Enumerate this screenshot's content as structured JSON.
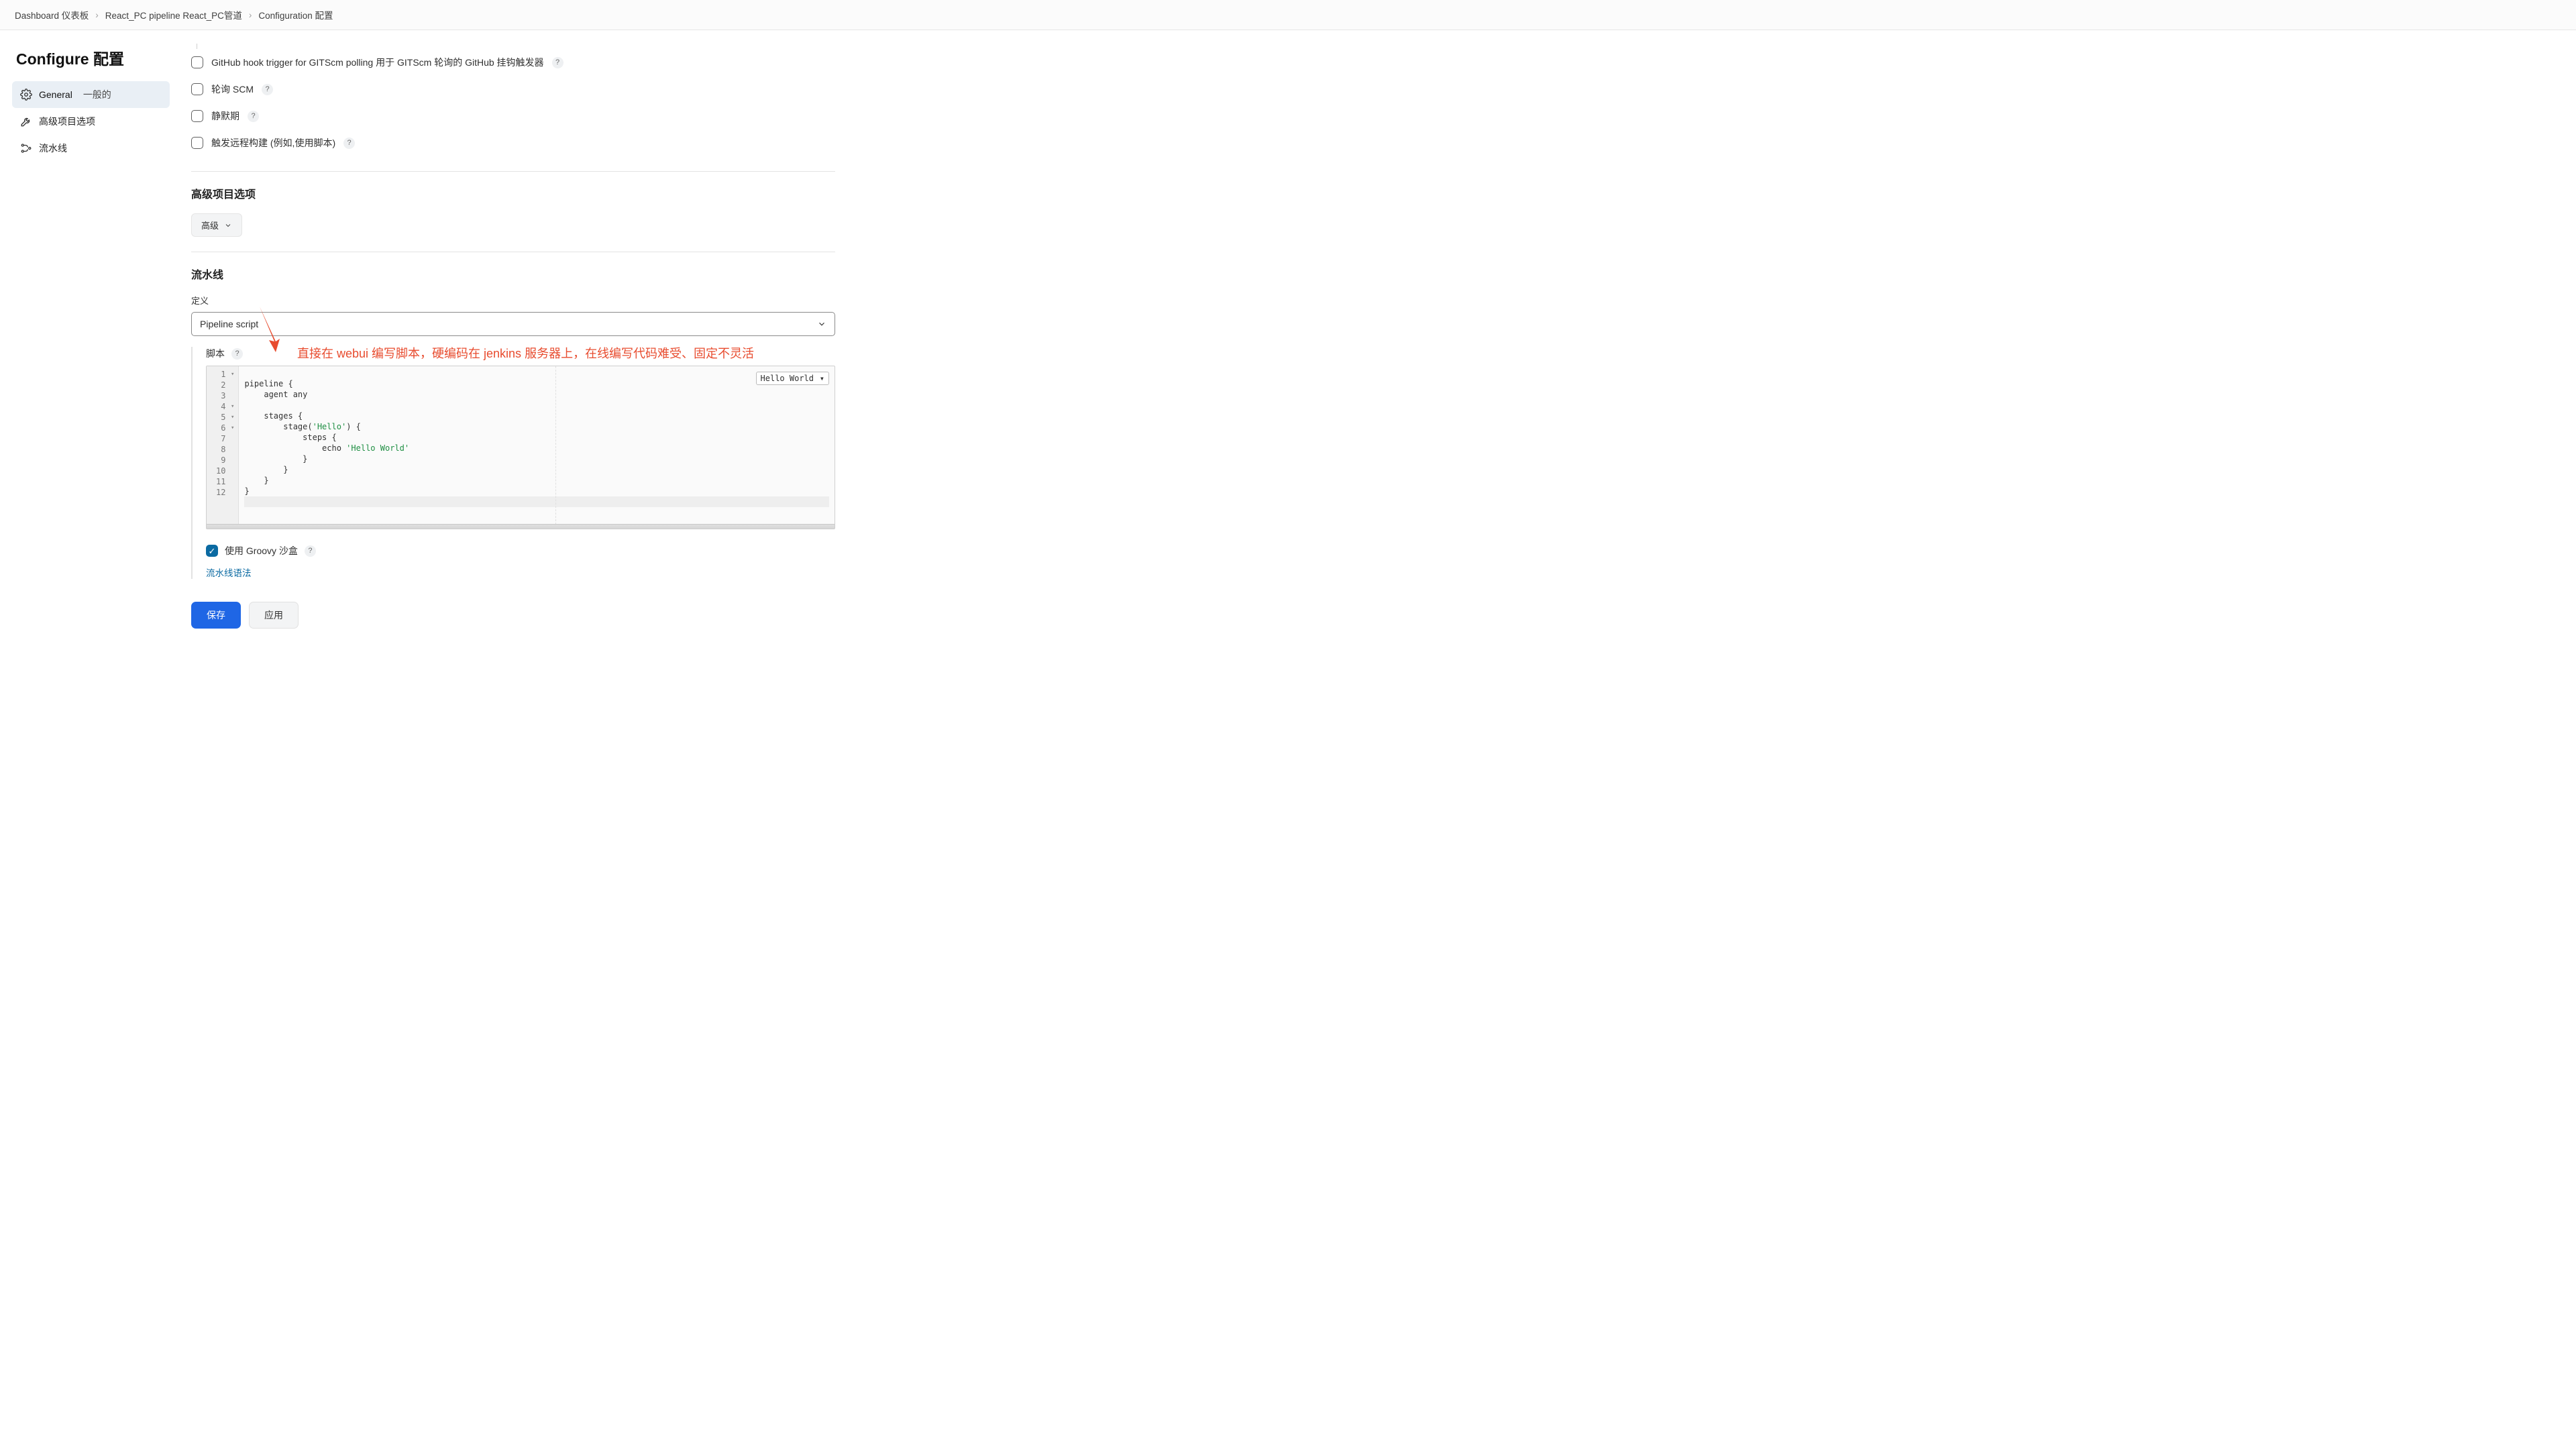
{
  "breadcrumbs": [
    "Dashboard 仪表板",
    "React_PC pipeline React_PC管道",
    "Configuration 配置"
  ],
  "page_title": "Configure 配置",
  "sidebar": {
    "items": [
      {
        "label_en": "General",
        "label_zh": "一般的"
      },
      {
        "label": "高级项目选项"
      },
      {
        "label": "流水线"
      }
    ]
  },
  "triggers": {
    "github_hook": "GitHub hook trigger for GITScm polling 用于 GITScm 轮询的 GitHub 挂钩触发器",
    "poll_scm": "轮询 SCM",
    "quiet_period": "静默期",
    "remote_trigger": "触发远程构建 (例如,使用脚本)"
  },
  "advanced_title": "高级项目选项",
  "advanced_btn": "高级",
  "pipeline_title": "流水线",
  "definition_label": "定义",
  "definition_value": "Pipeline script",
  "annotation": "直接在 webui 编写脚本，硬编码在 jenkins 服务器上，在线编写代码难受、固定不灵活",
  "script_label": "脚本",
  "sample_option": "Hello World",
  "code_lines": [
    "pipeline {",
    "    agent any",
    "",
    "    stages {",
    "        stage('Hello') {",
    "            steps {",
    "                echo 'Hello World'",
    "            }",
    "        }",
    "    }",
    "}",
    ""
  ],
  "sandbox_label": "使用 Groovy 沙盒",
  "syntax_link": "流水线语法",
  "buttons": {
    "save": "保存",
    "apply": "应用"
  }
}
